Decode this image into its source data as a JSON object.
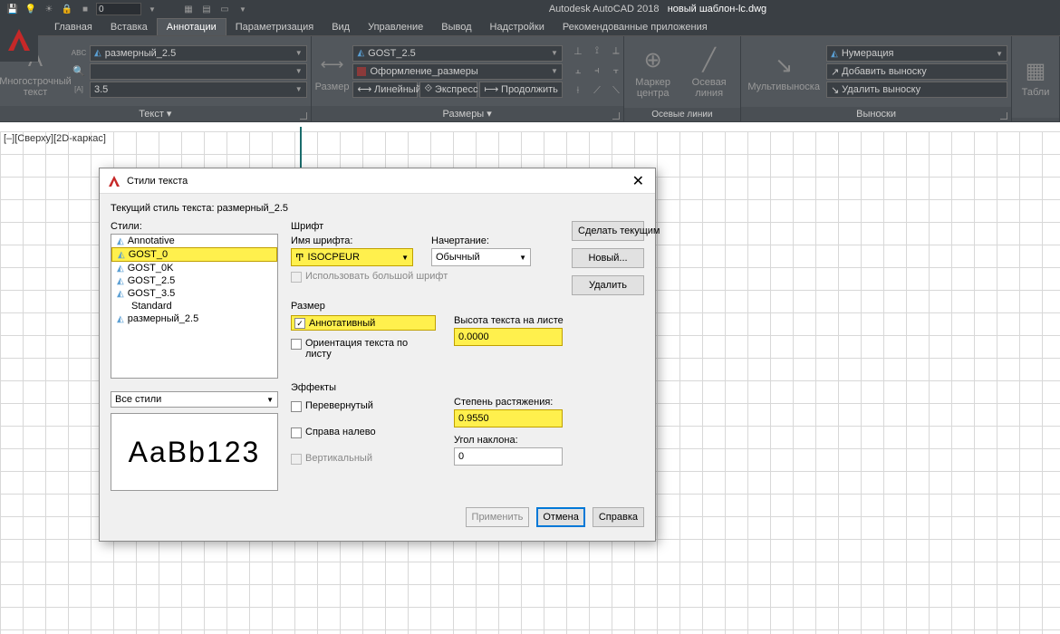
{
  "titlebar": {
    "app": "Autodesk AutoCAD 2018",
    "file": "новый шаблон-lc.dwg",
    "qat_input": "0"
  },
  "tabs": [
    "Главная",
    "Вставка",
    "Аннотации",
    "Параметризация",
    "Вид",
    "Управление",
    "Вывод",
    "Надстройки",
    "Рекомендованные приложения"
  ],
  "active_tab": "Аннотации",
  "ribbon": {
    "text_panel": {
      "title": "Текст ▾",
      "mtext": "Многострочный\nтекст",
      "style_combo": "размерный_2.5",
      "height_combo": "3.5"
    },
    "dim_panel": {
      "title": "Размеры ▾",
      "dim": "Размер",
      "style_combo": "GOST_2.5",
      "layer_combo": "Оформление_размеры",
      "linear": "Линейный",
      "express": "Экспресс",
      "continue": "Продолжить"
    },
    "axes_panel": {
      "title": "Осевые линии",
      "marker": "Маркер\nцентра",
      "centerline": "Осевая линия"
    },
    "leaders_panel": {
      "title": "Выноски",
      "mleader": "Мультивыноска",
      "num_combo": "Нумерация",
      "add_leader": "Добавить выноску",
      "rem_leader": "Удалить выноску"
    },
    "tables_panel": {
      "title": "",
      "tables": "Табли"
    }
  },
  "viewlabel": "[–][Сверху][2D-каркас]",
  "dialog": {
    "title": "Стили текста",
    "current": "Текущий стиль текста:  размерный_2.5",
    "styles_label": "Стили:",
    "styles": [
      "Annotative",
      "GOST_0",
      "GOST_0K",
      "GOST_2.5",
      "GOST_3.5",
      "Standard",
      "размерный_2.5"
    ],
    "selected_style": "GOST_0",
    "filter": "Все стили",
    "preview": "AaBb123",
    "font": {
      "group": "Шрифт",
      "name_label": "Имя шрифта:",
      "name": "ISOCPEUR",
      "style_label": "Начертание:",
      "style": "Обычный",
      "bigfont": "Использовать большой шрифт"
    },
    "size": {
      "group": "Размер",
      "annotative": "Аннотативный",
      "orientation": "Ориентация текста по листу",
      "paperheight_label": "Высота текста на листе",
      "paperheight": "0.0000"
    },
    "effects": {
      "group": "Эффекты",
      "upside": "Перевернутый",
      "backwards": "Справа налево",
      "vertical": "Вертикальный",
      "width_label": "Степень растяжения:",
      "width": "0.9550",
      "oblique_label": "Угол наклона:",
      "oblique": "0"
    },
    "buttons": {
      "setcurrent": "Сделать текущим",
      "new": "Новый...",
      "delete": "Удалить",
      "apply": "Применить",
      "cancel": "Отмена",
      "help": "Справка"
    }
  }
}
